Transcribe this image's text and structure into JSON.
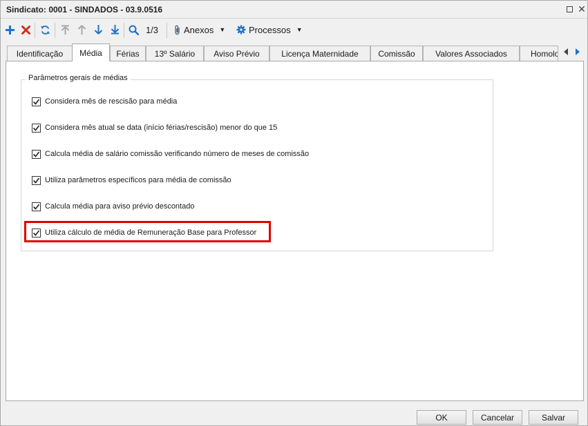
{
  "window": {
    "title": "Sindicato: 0001 - SINDADOS - 03.9.0516"
  },
  "toolbar": {
    "record_counter": "1/3",
    "anexos_label": "Anexos",
    "processos_label": "Processos"
  },
  "tabs": [
    {
      "label": "Identificação",
      "active": false
    },
    {
      "label": "Média",
      "active": true
    },
    {
      "label": "Férias",
      "active": false
    },
    {
      "label": "13º Salário",
      "active": false
    },
    {
      "label": "Aviso Prévio",
      "active": false
    },
    {
      "label": "Licença Maternidade",
      "active": false
    },
    {
      "label": "Comissão",
      "active": false
    },
    {
      "label": "Valores Associados",
      "active": false
    },
    {
      "label": "Homolo",
      "active": false
    }
  ],
  "group": {
    "legend": "Parâmetros gerais de médias",
    "options": [
      {
        "label": "Considera mês de rescisão para média",
        "checked": true
      },
      {
        "label": "Considera mês atual se data (início férias/rescisão) menor do que 15",
        "checked": true
      },
      {
        "label": "Calcula média de salário comissão verificando número de meses de comissão",
        "checked": true
      },
      {
        "label": "Utiliza parâmetros específicos para média de comissão",
        "checked": true
      },
      {
        "label": "Calcula média para aviso prévio descontado",
        "checked": true
      },
      {
        "label": "Utiliza cálculo de média de Remuneração Base para Professor",
        "checked": true
      }
    ]
  },
  "footer": {
    "ok_label": "OK",
    "cancel_label": "Cancelar",
    "save_label": "Salvar"
  },
  "colors": {
    "highlight": "#e00000",
    "add_icon": "#1e73c8",
    "delete_icon": "#d52b1e"
  }
}
